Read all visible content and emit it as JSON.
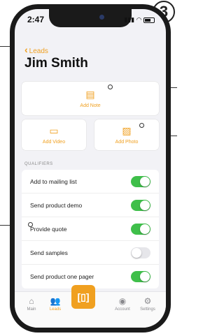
{
  "step": "3",
  "status_bar": {
    "time": "2:47"
  },
  "nav": {
    "back_label": "Leads"
  },
  "page_title": "Jim Smith",
  "actions": {
    "add_note": "Add Note",
    "add_video": "Add Video",
    "add_photo": "Add Photo"
  },
  "section_label": "QUALIFIERS",
  "qualifiers": [
    {
      "label": "Add to mailing list",
      "on": true
    },
    {
      "label": "Send product demo",
      "on": true
    },
    {
      "label": "Provide quote",
      "on": true
    },
    {
      "label": "Send samples",
      "on": false
    },
    {
      "label": "Send product one pager",
      "on": true
    }
  ],
  "tabs": [
    {
      "label": "Main",
      "icon": "house-icon",
      "active": false
    },
    {
      "label": "Leads",
      "icon": "people-icon",
      "active": true
    },
    {
      "label": "",
      "icon": "scan-icon",
      "active": false
    },
    {
      "label": "Account",
      "icon": "person-circle-icon",
      "active": false
    },
    {
      "label": "Settings",
      "icon": "gear-icon",
      "active": false
    }
  ],
  "colors": {
    "accent": "#f0a020",
    "toggle_on": "#3fbf4a"
  }
}
